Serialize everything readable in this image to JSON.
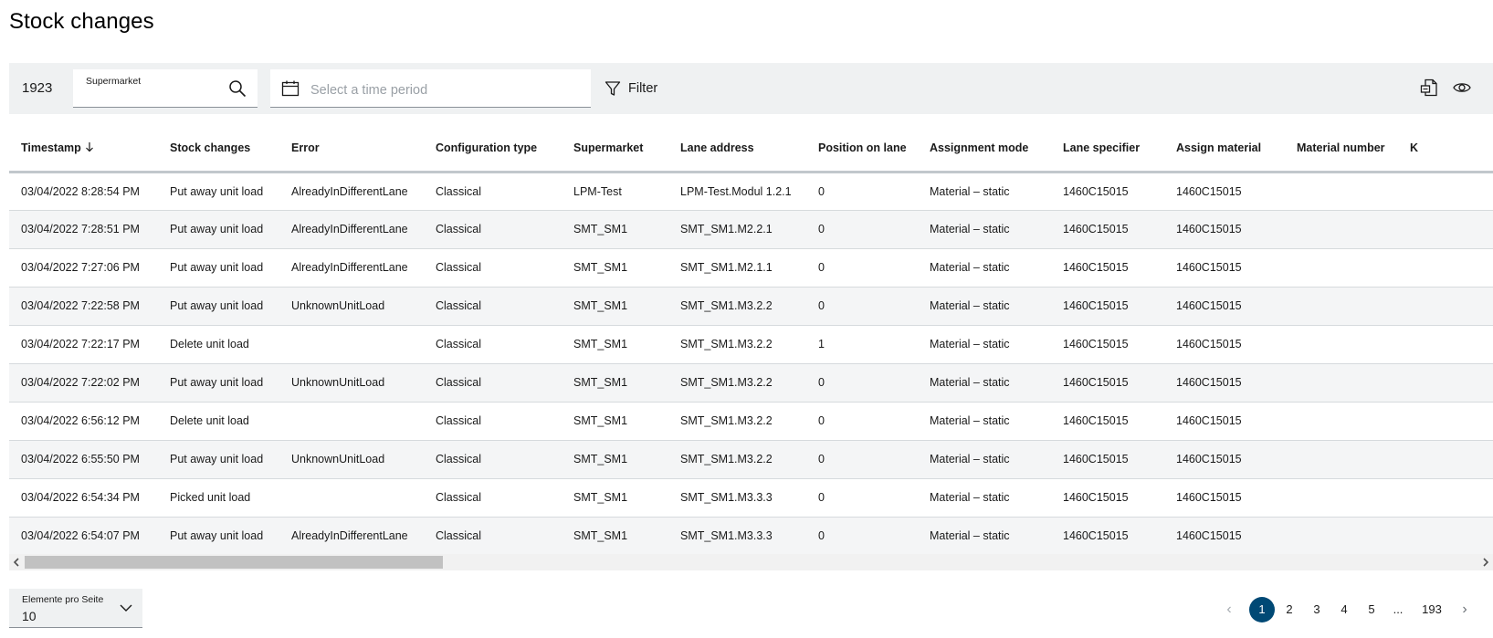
{
  "page": {
    "title": "Stock changes"
  },
  "toolbar": {
    "count": "1923",
    "search_label": "Supermarket",
    "search_value": "",
    "date_placeholder": "Select a time period",
    "filter_label": "Filter",
    "icons": {
      "search": "search-icon",
      "calendar": "calendar-icon",
      "filter": "filter-icon",
      "export": "export-icon",
      "view": "eye-icon"
    }
  },
  "table": {
    "columns": [
      "Timestamp",
      "Stock changes",
      "Error",
      "Configuration type",
      "Supermarket",
      "Lane address",
      "Position on lane",
      "Assignment mode",
      "Lane specifier",
      "Assign material",
      "Material number",
      "K"
    ],
    "sort_column": "Timestamp",
    "sort_direction": "descending",
    "rows": [
      [
        "03/04/2022 8:28:54 PM",
        "Put away unit load",
        "AlreadyInDifferentLane",
        "Classical",
        "LPM-Test",
        "LPM-Test.Modul 1.2.1",
        "0",
        "Material – static",
        "1460C15015",
        "1460C15015",
        "",
        ""
      ],
      [
        "03/04/2022 7:28:51 PM",
        "Put away unit load",
        "AlreadyInDifferentLane",
        "Classical",
        "SMT_SM1",
        "SMT_SM1.M2.2.1",
        "0",
        "Material – static",
        "1460C15015",
        "1460C15015",
        "",
        ""
      ],
      [
        "03/04/2022 7:27:06 PM",
        "Put away unit load",
        "AlreadyInDifferentLane",
        "Classical",
        "SMT_SM1",
        "SMT_SM1.M2.1.1",
        "0",
        "Material – static",
        "1460C15015",
        "1460C15015",
        "",
        ""
      ],
      [
        "03/04/2022 7:22:58 PM",
        "Put away unit load",
        "UnknownUnitLoad",
        "Classical",
        "SMT_SM1",
        "SMT_SM1.M3.2.2",
        "0",
        "Material – static",
        "1460C15015",
        "1460C15015",
        "",
        ""
      ],
      [
        "03/04/2022 7:22:17 PM",
        "Delete unit load",
        "",
        "Classical",
        "SMT_SM1",
        "SMT_SM1.M3.2.2",
        "1",
        "Material – static",
        "1460C15015",
        "1460C15015",
        "",
        ""
      ],
      [
        "03/04/2022 7:22:02 PM",
        "Put away unit load",
        "UnknownUnitLoad",
        "Classical",
        "SMT_SM1",
        "SMT_SM1.M3.2.2",
        "0",
        "Material – static",
        "1460C15015",
        "1460C15015",
        "",
        ""
      ],
      [
        "03/04/2022 6:56:12 PM",
        "Delete unit load",
        "",
        "Classical",
        "SMT_SM1",
        "SMT_SM1.M3.2.2",
        "0",
        "Material – static",
        "1460C15015",
        "1460C15015",
        "",
        ""
      ],
      [
        "03/04/2022 6:55:50 PM",
        "Put away unit load",
        "UnknownUnitLoad",
        "Classical",
        "SMT_SM1",
        "SMT_SM1.M3.2.2",
        "0",
        "Material – static",
        "1460C15015",
        "1460C15015",
        "",
        ""
      ],
      [
        "03/04/2022 6:54:34 PM",
        "Picked unit load",
        "",
        "Classical",
        "SMT_SM1",
        "SMT_SM1.M3.3.3",
        "0",
        "Material – static",
        "1460C15015",
        "1460C15015",
        "",
        ""
      ],
      [
        "03/04/2022 6:54:07 PM",
        "Put away unit load",
        "AlreadyInDifferentLane",
        "Classical",
        "SMT_SM1",
        "SMT_SM1.M3.3.3",
        "0",
        "Material – static",
        "1460C15015",
        "1460C15015",
        "",
        ""
      ]
    ]
  },
  "footer": {
    "per_page_label": "Elemente pro Seite",
    "per_page_value": "10",
    "pagination": {
      "prev": "‹",
      "pages": [
        "1",
        "2",
        "3",
        "4",
        "5"
      ],
      "ellipsis": "...",
      "last": "193",
      "next": "›",
      "current": "1"
    }
  },
  "colors": {
    "accent": "#004975",
    "toolbar_bg": "#eff1f2",
    "row_alt": "#f4f5f6"
  }
}
